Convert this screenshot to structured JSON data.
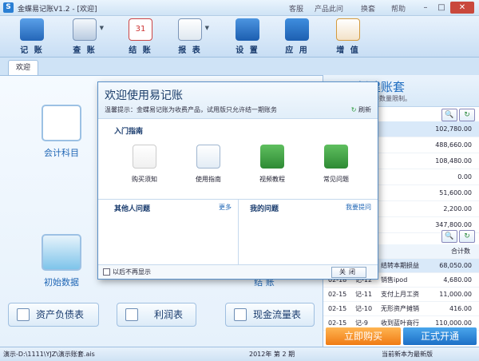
{
  "window": {
    "title": "金蝶易记账V1.2 - [欢迎]",
    "links": [
      "客服",
      "产品此问",
      "换套",
      "帮助"
    ]
  },
  "toolbar": {
    "items": [
      "记 账",
      "查 账",
      "结 账",
      "报 表",
      "设 置",
      "应 用",
      "增 值"
    ],
    "calendar_day": "31"
  },
  "tabs": [
    "欢迎"
  ],
  "left": {
    "icons": [
      "会计科目",
      "初始数据",
      "结 账"
    ],
    "bottom_buttons": [
      "资产负债表",
      "利润表",
      "现金流量表"
    ]
  },
  "right": {
    "title": "新建账套",
    "subtitle": "账套，无账套数量限制。",
    "values": [
      "102,780.00",
      "488,660.00",
      "108,480.00",
      "0.00",
      "51,600.00",
      "2,200.00",
      "347,800.00"
    ],
    "header_total": "合计数",
    "transactions": [
      {
        "date": "",
        "no": "",
        "desc": "结转本期损益",
        "amount": "68,050.00"
      },
      {
        "date": "02-18",
        "no": "记-12",
        "desc": "销售ipod",
        "amount": "4,680.00"
      },
      {
        "date": "02-15",
        "no": "记-11",
        "desc": "支付上月工资",
        "amount": "11,000.00"
      },
      {
        "date": "02-15",
        "no": "记-10",
        "desc": "无形资产摊销",
        "amount": "416.00"
      },
      {
        "date": "02-15",
        "no": "记-9",
        "desc": "收到蓝叶商行",
        "amount": "110,000.00"
      }
    ],
    "buy_label": "立即购买",
    "open_label": "正式开通"
  },
  "status": {
    "path": "演示-D:\\1111\\YJZ\\演示账套.ais",
    "period": "2012年 第 2 期",
    "version": "当前新本为最新版"
  },
  "dialog": {
    "title": "欢迎使用易记账",
    "tip": "温馨提示：金蝶易记账为收费产品，试用版只允许结一期账务",
    "refresh": "刷新",
    "guide": "入门指南",
    "guide_items": [
      "购买须知",
      "使用指南",
      "视频教程",
      "常见问题"
    ],
    "others_title": "其他人问题",
    "more": "更多",
    "mine_title": "我的问题",
    "ask": "我要提问",
    "no_show": "以后不再显示",
    "close": "关闭"
  }
}
